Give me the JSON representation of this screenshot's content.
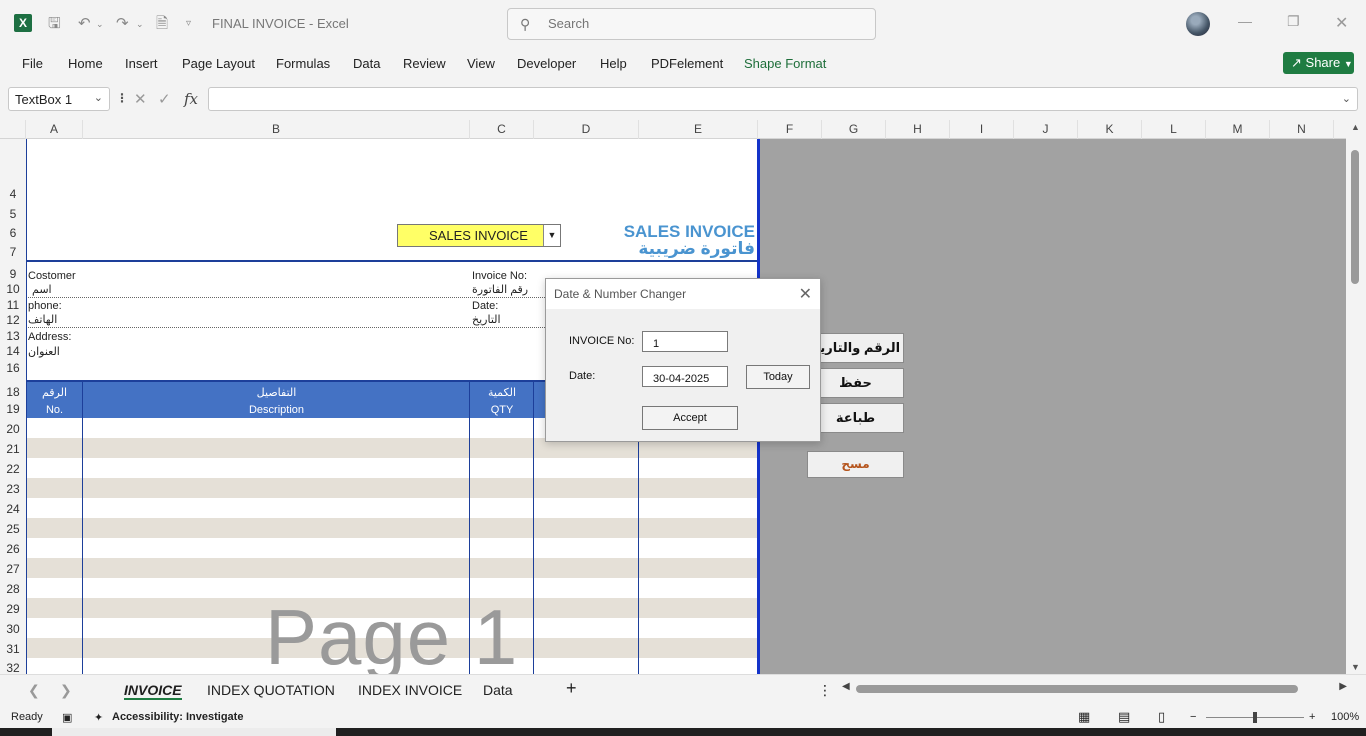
{
  "window": {
    "title": "FINAL INVOICE  -  Excel",
    "search_placeholder": "Search"
  },
  "menu": {
    "items": [
      "File",
      "Home",
      "Insert",
      "Page Layout",
      "Formulas",
      "Data",
      "Review",
      "View",
      "Developer",
      "Help",
      "PDFelement",
      "Shape Format"
    ],
    "share_label": "Share"
  },
  "formula_bar": {
    "name_box": "TextBox 1",
    "fx_label": "fx",
    "formula": ""
  },
  "columns": [
    "A",
    "B",
    "C",
    "D",
    "E",
    "F",
    "G",
    "H",
    "I",
    "J",
    "K",
    "L",
    "M",
    "N"
  ],
  "rows": [
    "4",
    "5",
    "6",
    "7",
    "9",
    "10",
    "11",
    "12",
    "13",
    "14",
    "16",
    "18",
    "19",
    "20",
    "21",
    "22",
    "23",
    "24",
    "25",
    "26",
    "27",
    "28",
    "29",
    "30",
    "31",
    "32"
  ],
  "invoice": {
    "type_dropdown": "SALES INVOICE",
    "title_en": "SALES INVOICE",
    "title_ar": "فاتورة ضريبية",
    "customer_en": "Costomer",
    "customer_ar": "اسم",
    "phone_en": "phone:",
    "phone_ar": "الهاتف",
    "address_en": "Address:",
    "address_ar": "العنوان",
    "invoice_no_en": "Invoice No:",
    "invoice_no_ar": "رقم الفاتورة",
    "date_en": "Date:",
    "date_ar": "التاريخ",
    "col_no_ar": "الرقم",
    "col_no_en": "No.",
    "col_desc_ar": "التفاصيل",
    "col_desc_en": "Description",
    "col_qty_ar": "الكمية",
    "col_qty_en": "QTY",
    "page_label": "Page 1"
  },
  "macro_buttons": {
    "number_date": "الرقم والتاريخ",
    "save": "حفظ",
    "print": "طباعة",
    "clear": "مسح"
  },
  "dialog": {
    "title": "Date & Number Changer",
    "invoice_label": "INVOICE No:",
    "invoice_value": "1",
    "date_label": "Date:",
    "date_value": "30-04-2025",
    "today_button": "Today",
    "accept_button": "Accept"
  },
  "sheet_tabs": [
    "INVOICE",
    "INDEX QUOTATION",
    "INDEX INVOICE",
    "Data"
  ],
  "active_tab": "INVOICE",
  "status": {
    "ready": "Ready",
    "accessibility": "Accessibility: Investigate",
    "zoom": "100%"
  },
  "colors": {
    "header_blue": "#4472c4",
    "title_blue": "#4a94d0",
    "dropdown_yellow": "#ffff66",
    "row_alt": "#e5e0d7",
    "excel_green": "#1f7c42"
  }
}
